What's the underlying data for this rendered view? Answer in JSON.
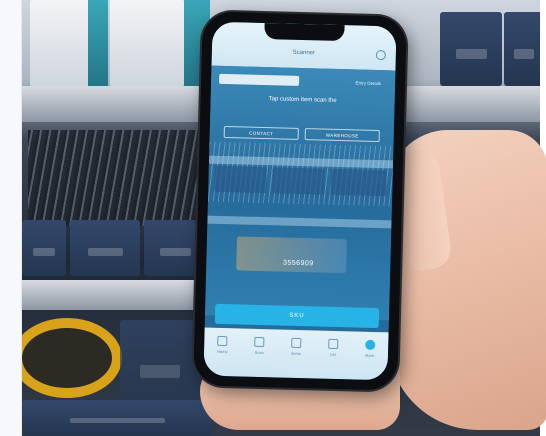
{
  "app": {
    "header_title": "Scanner",
    "scan_button": "SKU",
    "barcode_value": "3556909",
    "right_label": "Entry Details",
    "instruction_text": "Tap custom item scan the",
    "secondary_buttons": [
      "CONTACT",
      "WAREHOUSE"
    ]
  },
  "tabs": [
    {
      "label": "Home"
    },
    {
      "label": "Scan"
    },
    {
      "label": "Items"
    },
    {
      "label": "List"
    },
    {
      "label": "More"
    }
  ],
  "colors": {
    "accent": "#27b3e6",
    "screen_blue": "#2a6e9e",
    "bin_navy": "#243650",
    "coil_yellow": "#d9a21b"
  }
}
